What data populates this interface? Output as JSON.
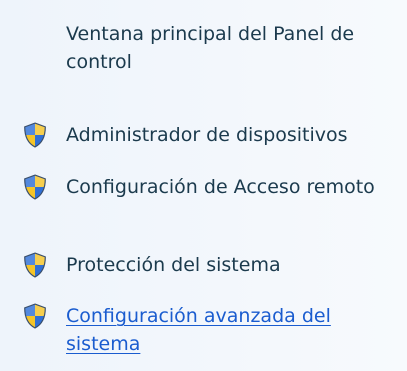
{
  "header": {
    "link_label": "Ventana principal del Panel de control"
  },
  "tasks": [
    {
      "label": "Administrador de dispositivos",
      "icon": "uac-shield-icon"
    },
    {
      "label": "Configuración de Acceso remoto",
      "icon": "uac-shield-icon"
    },
    {
      "label": "Protección del sistema",
      "icon": "uac-shield-icon"
    },
    {
      "label": "Configuración avanzada del sistema",
      "icon": "uac-shield-icon",
      "state": "hover"
    }
  ],
  "colors": {
    "link_text": "#1b3a4d",
    "link_hover": "#1a5ccf",
    "shield_blue": "#2f6fd6",
    "shield_yellow": "#f5c428"
  }
}
